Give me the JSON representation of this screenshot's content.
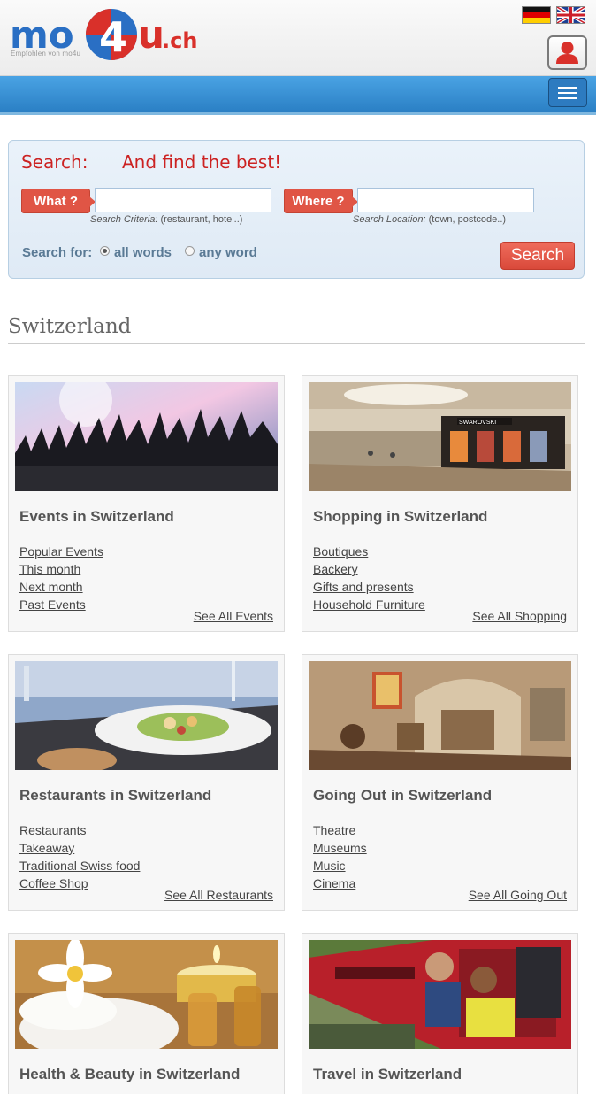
{
  "header": {
    "logo_text_a": "mo",
    "logo_text_b": "4",
    "logo_text_c": "u",
    "logo_text_d": ".ch",
    "logo_sub": "Empfohlen von mo4u"
  },
  "search": {
    "title": "Search:",
    "tagline": "And find the best!",
    "what_label": "What ?",
    "where_label": "Where ?",
    "what_value": "",
    "where_value": "",
    "what_hint_em": "Search Criteria:",
    "what_hint": " (restaurant, hotel..)",
    "where_hint_em": "Search Location:",
    "where_hint": " (town, postcode..)",
    "search_for_label": "Search for:",
    "option_all": "all words",
    "option_any": "any word",
    "selected_option": "all words",
    "button_label": "Search"
  },
  "section": {
    "title": "Switzerland"
  },
  "cards": [
    {
      "title": "Events in Switzerland",
      "links": [
        "Popular Events",
        "This month",
        "Next month",
        "Past Events"
      ],
      "see_all": "See All Events"
    },
    {
      "title": "Shopping in Switzerland",
      "links": [
        "Boutiques",
        "Backery",
        "Gifts and presents",
        "Household Furniture"
      ],
      "see_all": "See All Shopping"
    },
    {
      "title": "Restaurants in Switzerland",
      "links": [
        "Restaurants",
        "Takeaway",
        "Traditional Swiss food",
        "Coffee Shop"
      ],
      "see_all": "See All Restaurants"
    },
    {
      "title": "Going Out in Switzerland",
      "links": [
        "Theatre",
        "Museums",
        "Music",
        "Cinema"
      ],
      "see_all": "See All Going Out"
    },
    {
      "title": "Health & Beauty in Switzerland",
      "links": [],
      "see_all": ""
    },
    {
      "title": "Travel in Switzerland",
      "links": [],
      "see_all": ""
    }
  ],
  "images": {
    "store_sign": "SWAROVSKI"
  },
  "colors": {
    "brand_blue": "#2a6fc4",
    "brand_red": "#d9493a",
    "nav_blue": "#3a92d6",
    "search_red": "#cc2222"
  }
}
